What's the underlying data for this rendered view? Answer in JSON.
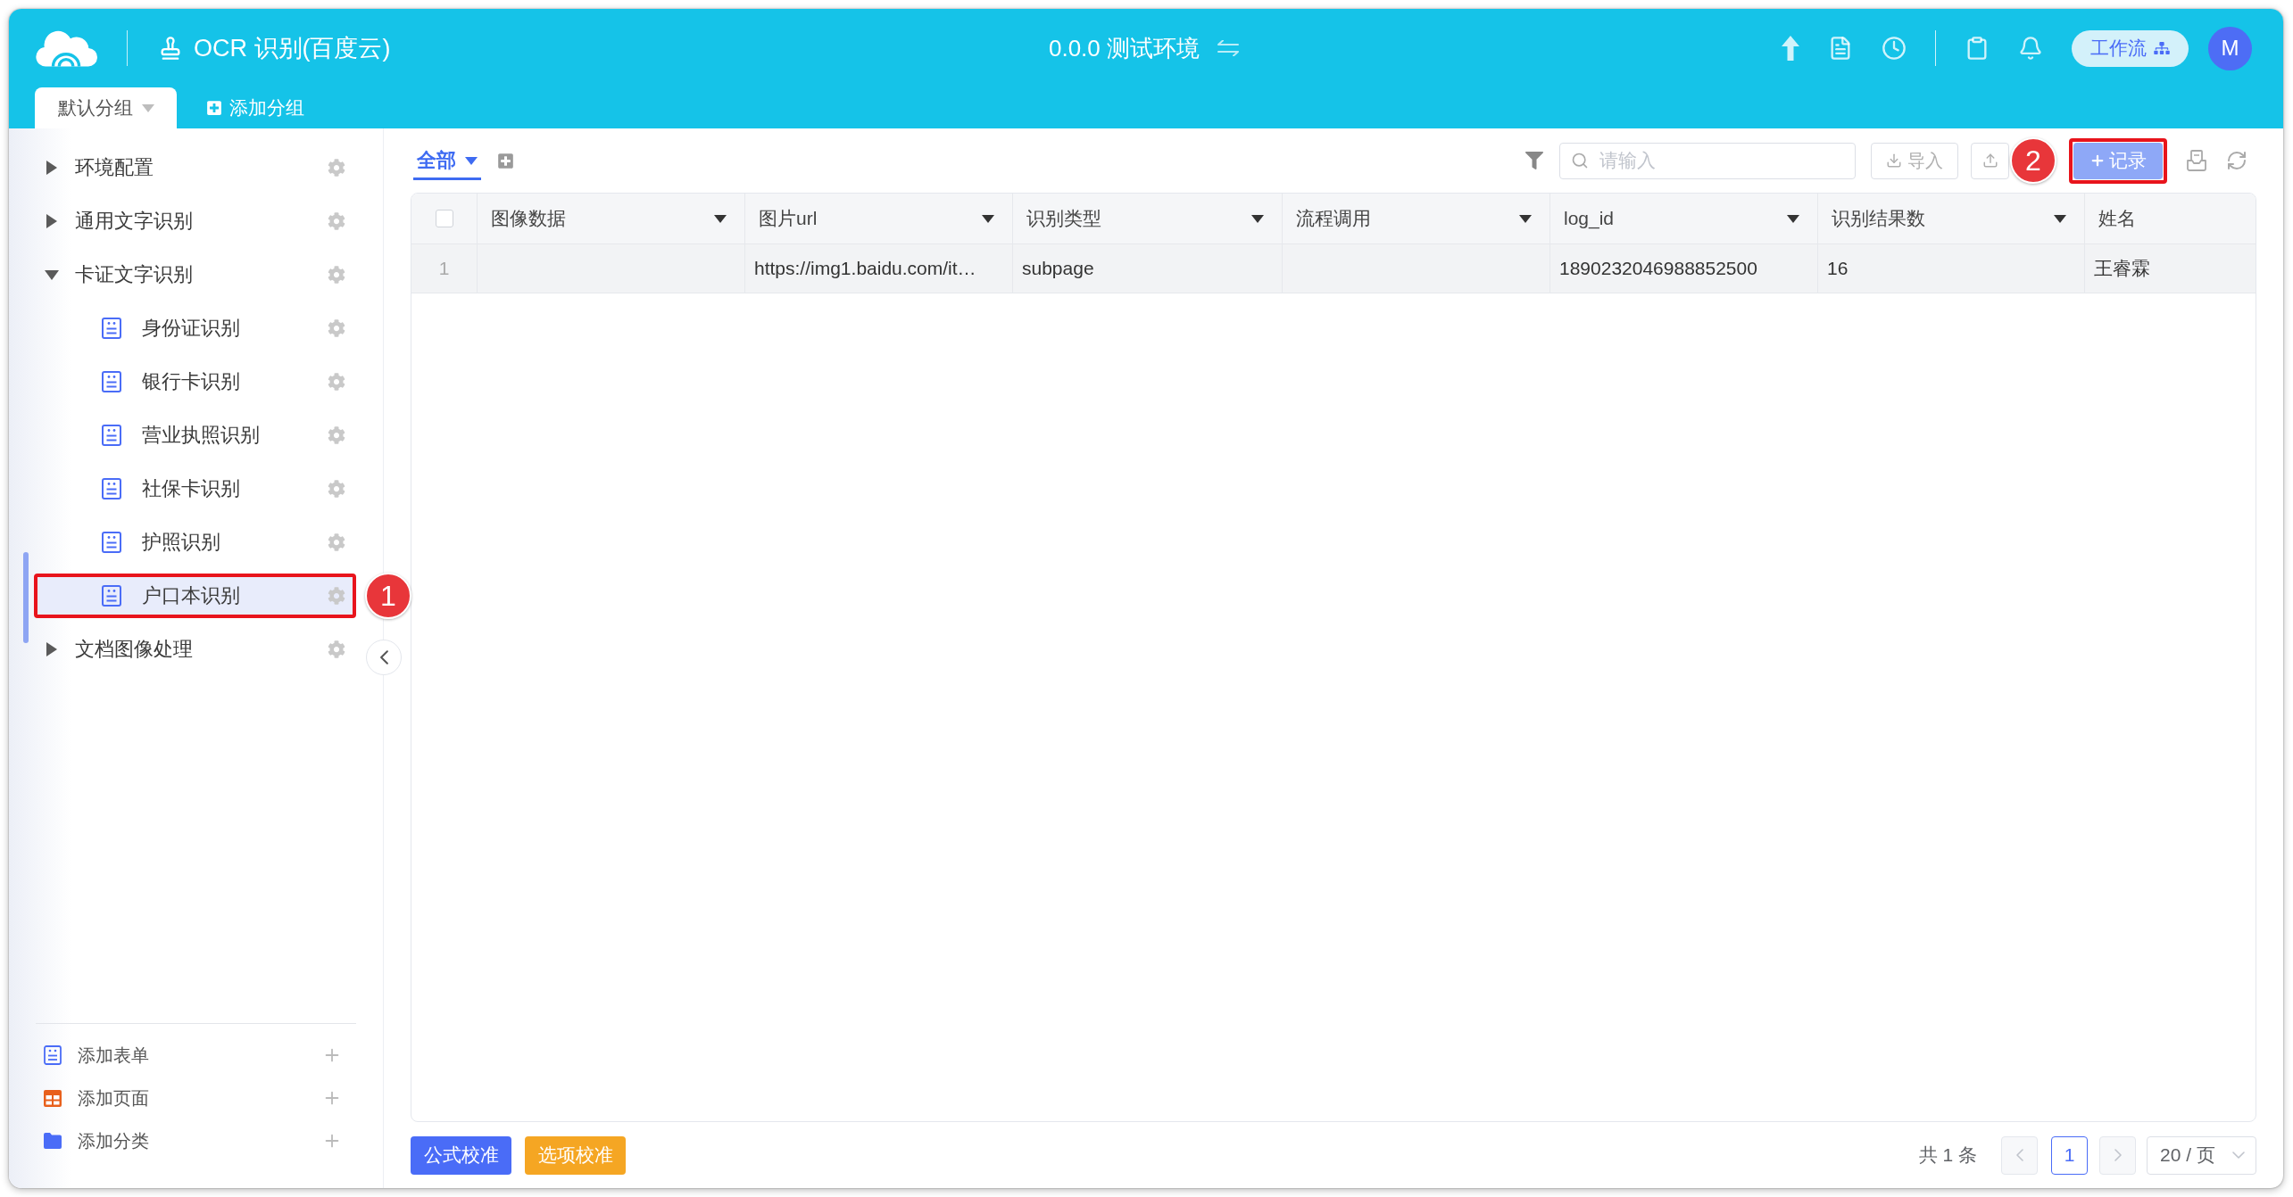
{
  "header": {
    "app_title": "OCR 识别(百度云)",
    "environment": "0.0.0 测试环境",
    "workflow_button": "工作流",
    "avatar_initial": "M",
    "group_tabs": [
      {
        "label": "默认分组",
        "selected": true
      }
    ],
    "add_group_button": "添加分组"
  },
  "sidebar": {
    "items": [
      {
        "kind": "group",
        "label": "环境配置",
        "selected": false,
        "expanded": false
      },
      {
        "kind": "group",
        "label": "通用文字识别",
        "selected": false,
        "expanded": false
      },
      {
        "kind": "group",
        "label": "卡证文字识别",
        "selected": false,
        "expanded": true,
        "children": [
          {
            "kind": "form",
            "label": "身份证识别",
            "selected": false
          },
          {
            "kind": "form",
            "label": "银行卡识别",
            "selected": false
          },
          {
            "kind": "form",
            "label": "营业执照识别",
            "selected": false
          },
          {
            "kind": "form",
            "label": "社保卡识别",
            "selected": false
          },
          {
            "kind": "form",
            "label": "护照识别",
            "selected": false
          },
          {
            "kind": "form",
            "label": "户口本识别",
            "selected": true,
            "callout": "1"
          }
        ]
      },
      {
        "kind": "group",
        "label": "文档图像处理",
        "selected": false,
        "expanded": false
      }
    ],
    "footer_actions": [
      {
        "kind": "form",
        "label": "添加表单"
      },
      {
        "kind": "page",
        "label": "添加页面"
      },
      {
        "kind": "folder",
        "label": "添加分类"
      }
    ]
  },
  "toolbar": {
    "view_tabs": [
      {
        "label": "全部",
        "selected": true
      }
    ],
    "search": {
      "placeholder": "请输入"
    },
    "import_button": "导入",
    "add_record_button": {
      "label": "记录",
      "callout": "2"
    }
  },
  "table": {
    "header_checkbox": {
      "checked": false
    },
    "columns": [
      {
        "label": "图像数据",
        "dropdown": true
      },
      {
        "label": "图片url",
        "dropdown": true
      },
      {
        "label": "识别类型",
        "dropdown": true
      },
      {
        "label": "流程调用",
        "dropdown": true
      },
      {
        "label": "log_id",
        "dropdown": true
      },
      {
        "label": "识别结果数",
        "dropdown": true
      },
      {
        "label": "姓名",
        "dropdown": false
      }
    ],
    "rows": [
      {
        "index": "1",
        "highlighted": true,
        "cells": [
          null,
          "https://img1.baidu.com/it…",
          "subpage",
          null,
          "1890232046988852500",
          "16",
          "王睿霖"
        ]
      }
    ]
  },
  "footer": {
    "buttons": [
      {
        "label": "公式校准",
        "color": "#4a6cf7"
      },
      {
        "label": "选项校准",
        "color": "#f5a623"
      }
    ],
    "total": "共 1 条",
    "pages": [
      {
        "label": "1",
        "selected": true
      }
    ],
    "page_size": "20 / 页"
  }
}
